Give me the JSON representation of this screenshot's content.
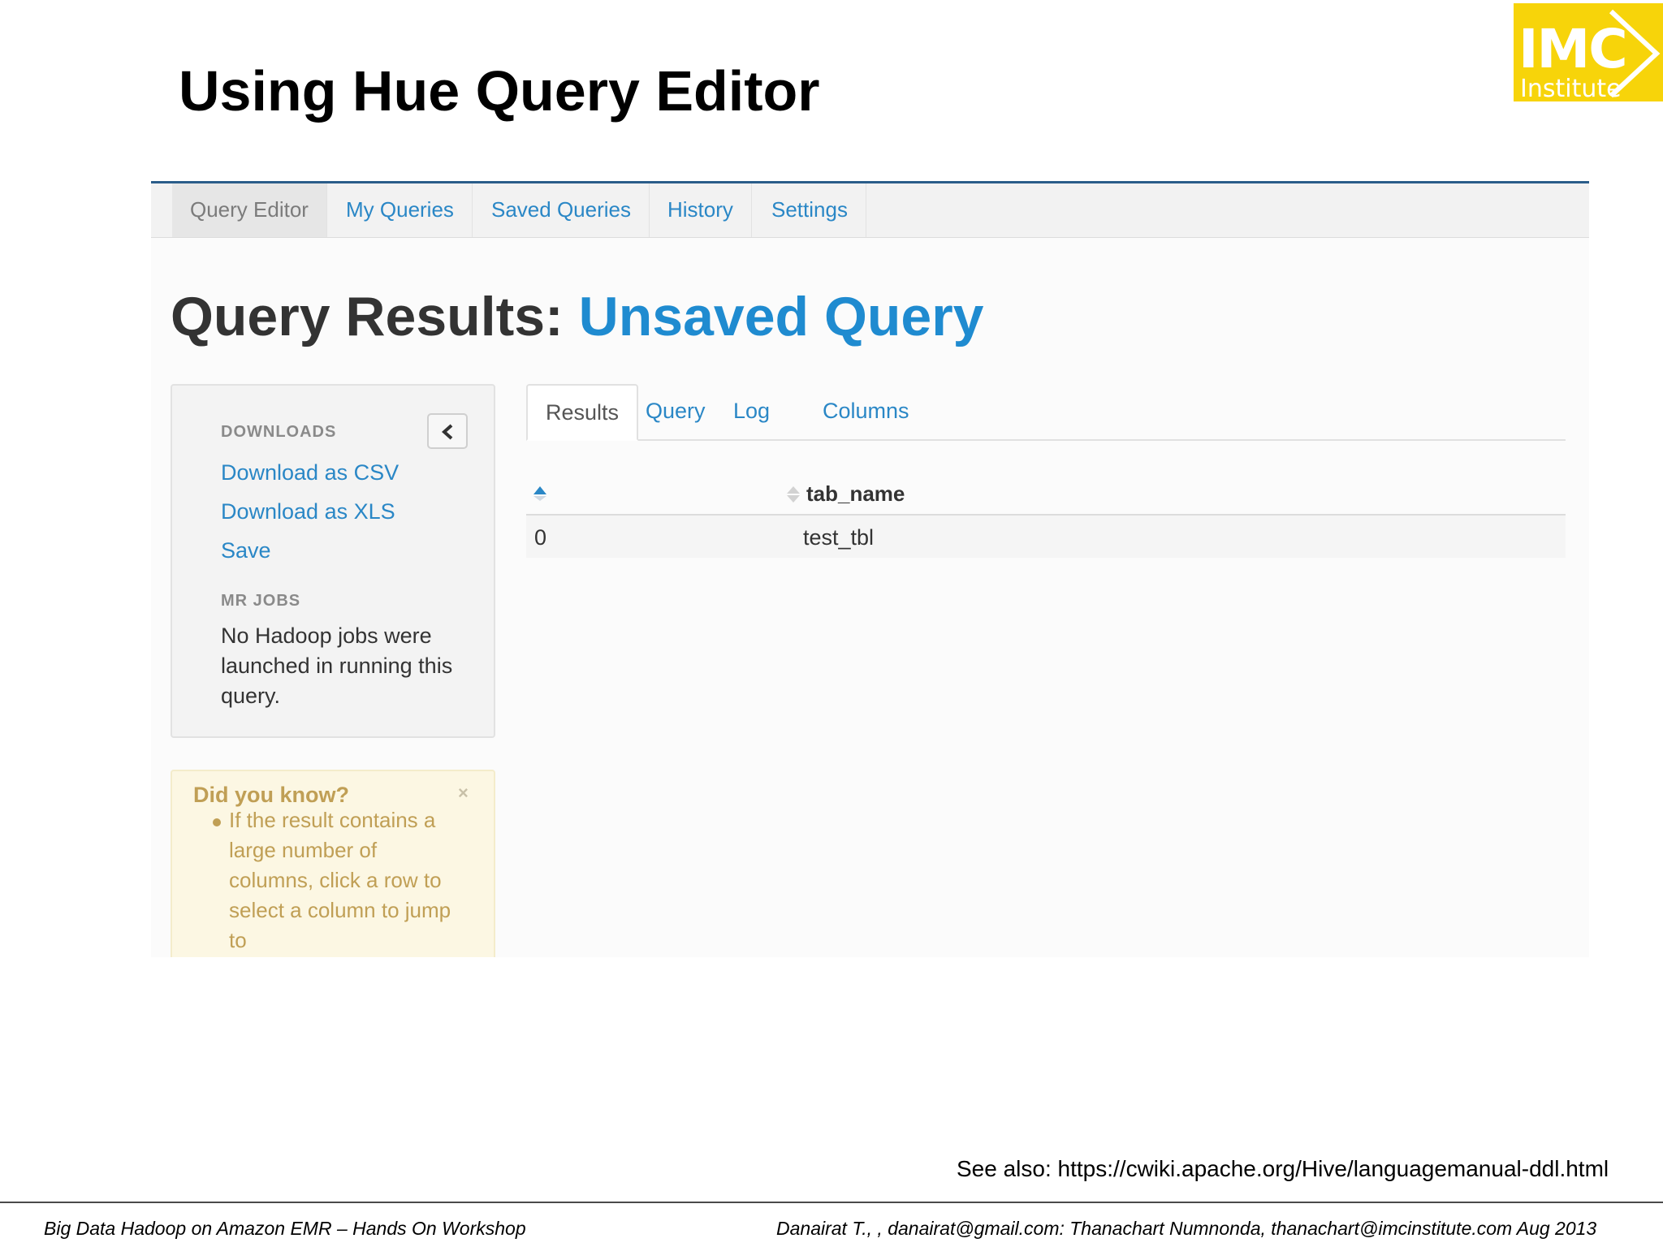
{
  "slide": {
    "title": "Using Hue Query Editor",
    "see_also": "See also: https://cwiki.apache.org/Hive/languagemanual-ddl.html",
    "footer_left": "Big Data Hadoop on Amazon EMR – Hands On Workshop",
    "footer_right": "Danairat T., , danairat@gmail.com:  Thanachart Numnonda,  thanachart@imcinstitute.com   Aug 2013"
  },
  "logo": {
    "main": "IMC",
    "sub": "Institute",
    "color": "#f7d40a"
  },
  "nav": {
    "items": [
      "Query Editor",
      "My Queries",
      "Saved Queries",
      "History",
      "Settings"
    ],
    "active": "Query Editor"
  },
  "page": {
    "title_prefix": "Query Results: ",
    "title_accent": "Unsaved Query",
    "accent_color": "#1f8bd0"
  },
  "sidebar": {
    "downloads_heading": "DOWNLOADS",
    "links": [
      "Download as CSV",
      "Download as XLS",
      "Save"
    ],
    "mr_heading": "MR JOBS",
    "mr_text": "No Hadoop jobs were launched in running this query.",
    "collapse_icon": "chevron-left-icon"
  },
  "tip": {
    "title": "Did you know?",
    "close": "×",
    "text": "If the result contains a large number of columns, click a row to select a column to jump to"
  },
  "tabs": {
    "items": [
      "Results",
      "Query",
      "Log",
      "Columns"
    ],
    "active": "Results"
  },
  "table": {
    "columns": [
      "",
      "tab_name"
    ],
    "rows": [
      [
        "0",
        "test_tbl"
      ]
    ]
  }
}
